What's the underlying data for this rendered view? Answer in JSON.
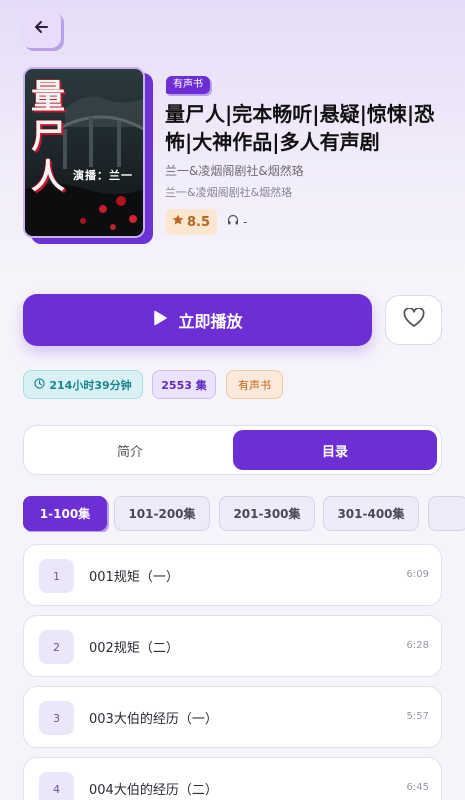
{
  "header": {
    "back_icon": "arrow-left-icon"
  },
  "book": {
    "badge": "有声书",
    "title": "量尸人|完本畅听|悬疑|惊悚|恐怖|大神作品|多人有声剧",
    "author_line1": "兰一&凌烟阁剧社&烟然珞",
    "author_line2": "兰一&凌烟阁剧社&烟然珞",
    "rating": "8.5",
    "listen_count": "-",
    "cover": {
      "title_text": "量尸人",
      "sub_text": "演播：兰一"
    }
  },
  "actions": {
    "play_label": "立即播放",
    "favorite_icon": "heart-icon"
  },
  "stats": {
    "duration": "214小时39分钟",
    "episodes": "2553 集",
    "type": "有声书"
  },
  "tabs": [
    {
      "label": "简介",
      "active": false
    },
    {
      "label": "目录",
      "active": true
    }
  ],
  "ranges": [
    "1-100集",
    "101-200集",
    "201-300集",
    "301-400集"
  ],
  "episodes": [
    {
      "num": "1",
      "title": "001规矩（一）",
      "duration": "6:09"
    },
    {
      "num": "2",
      "title": "002规矩（二）",
      "duration": "6:28"
    },
    {
      "num": "3",
      "title": "003大伯的经历（一）",
      "duration": "5:57"
    },
    {
      "num": "4",
      "title": "004大伯的经历（二）",
      "duration": "6:45"
    }
  ],
  "colors": {
    "accent": "#6d2ed6",
    "accent_light": "#b9a0ea"
  }
}
